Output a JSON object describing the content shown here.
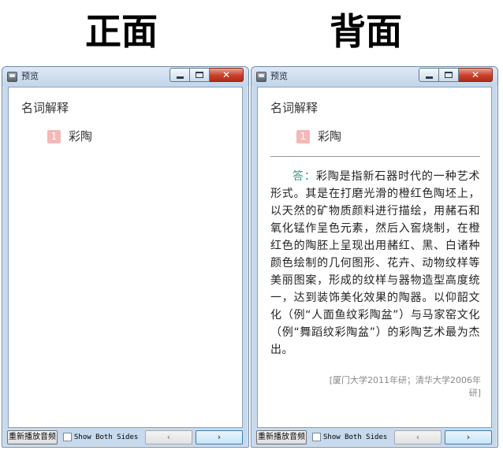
{
  "labels": {
    "front": "正面",
    "back": "背面"
  },
  "window": {
    "title": "预览"
  },
  "card": {
    "section": "名词解释",
    "term_number": "1",
    "term": "彩陶",
    "answer_label": "答：",
    "answer": "彩陶是指新石器时代的一种艺术形式。其是在打磨光滑的橙红色陶坯上，以天然的矿物质颜料进行描绘，用赭石和氧化锰作呈色元素，然后入窖烧制，在橙红色的陶胚上呈现出用赭红、黑、白诸种颜色绘制的几何图形、花卉、动物纹样等美丽图案，形成的纹样与器物造型高度统一，达到装饰美化效果的陶器。以仰韶文化（例“人面鱼纹彩陶盆”）与马家窑文化（例“舞蹈纹彩陶盆”）的彩陶艺术最为杰出。",
    "source": "[厦门大学2011年研；清华大学2006年研]"
  },
  "bottom": {
    "replay_label": "重新播放音频",
    "show_both_label": "Show Both Sides",
    "show_both_checked": false,
    "prev_label": "‹",
    "next_label": "›"
  },
  "icons": {
    "app": "app-icon",
    "minimize": "minimize-icon",
    "maximize": "maximize-icon",
    "close": "close-icon"
  }
}
